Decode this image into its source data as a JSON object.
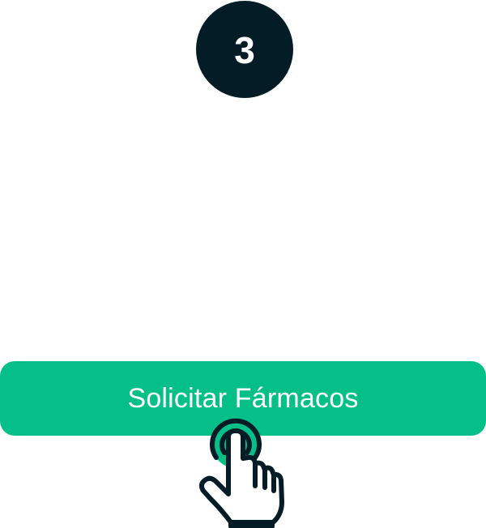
{
  "step": {
    "number": "3"
  },
  "cta": {
    "label": "Solicitar Fármacos"
  },
  "icons": {
    "tap": "hand-pointer-tap-icon"
  },
  "colors": {
    "badge": "#041c26",
    "button": "#05bf88",
    "icon_stroke": "#041c26",
    "text_on_dark": "#ffffff"
  }
}
